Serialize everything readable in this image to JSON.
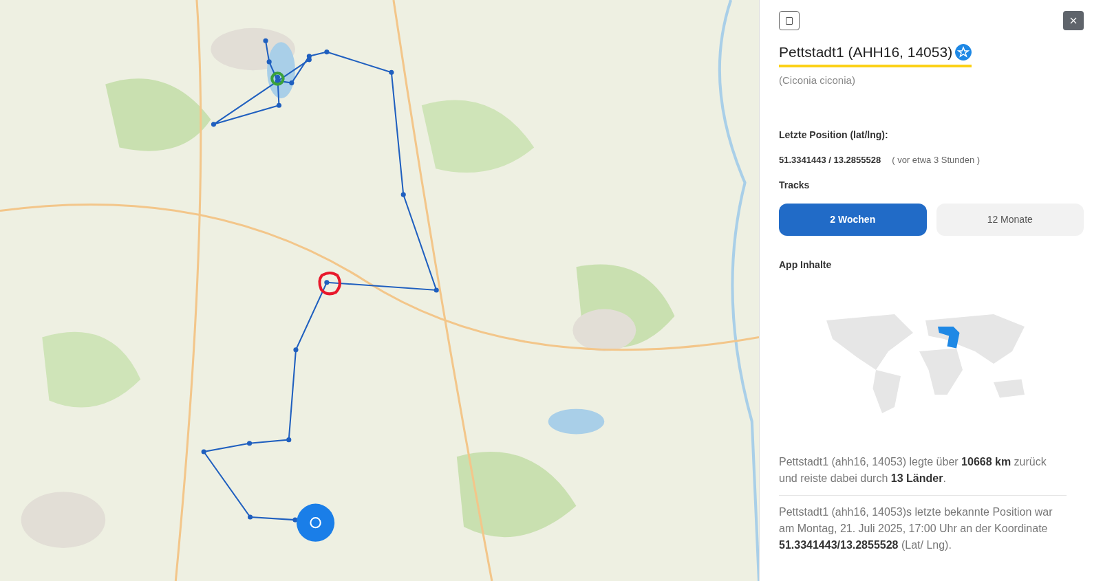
{
  "panel": {
    "title": "Pettstadt1 (AHH16, 14053)",
    "favorite": true,
    "subtitle": "(Ciconia ciconia)",
    "position_label": "Letzte Position (lat/lng):",
    "position_value": "51.3341443 / 13.2855528",
    "position_age": "( vor etwa 3 Stunden )",
    "tracks_label": "Tracks",
    "track_tabs": [
      {
        "label": "2 Wochen",
        "selected": true
      },
      {
        "label": "12 Monate",
        "selected": false
      }
    ],
    "content_label": "App Inhalte",
    "paragraphs": [
      "Pettstadt1 (ahh16, 14053) legte über **10668 km** zurück und reiste dabei durch **13 Länder**.",
      "Pettstadt1 (ahh16, 14053)s letzte bekannte Position war am Montag, 21. Juli 2025, 17:00 Uhr an der Koordinate **51.3341443/13.2855528** (Lat/ Lng)."
    ]
  }
}
